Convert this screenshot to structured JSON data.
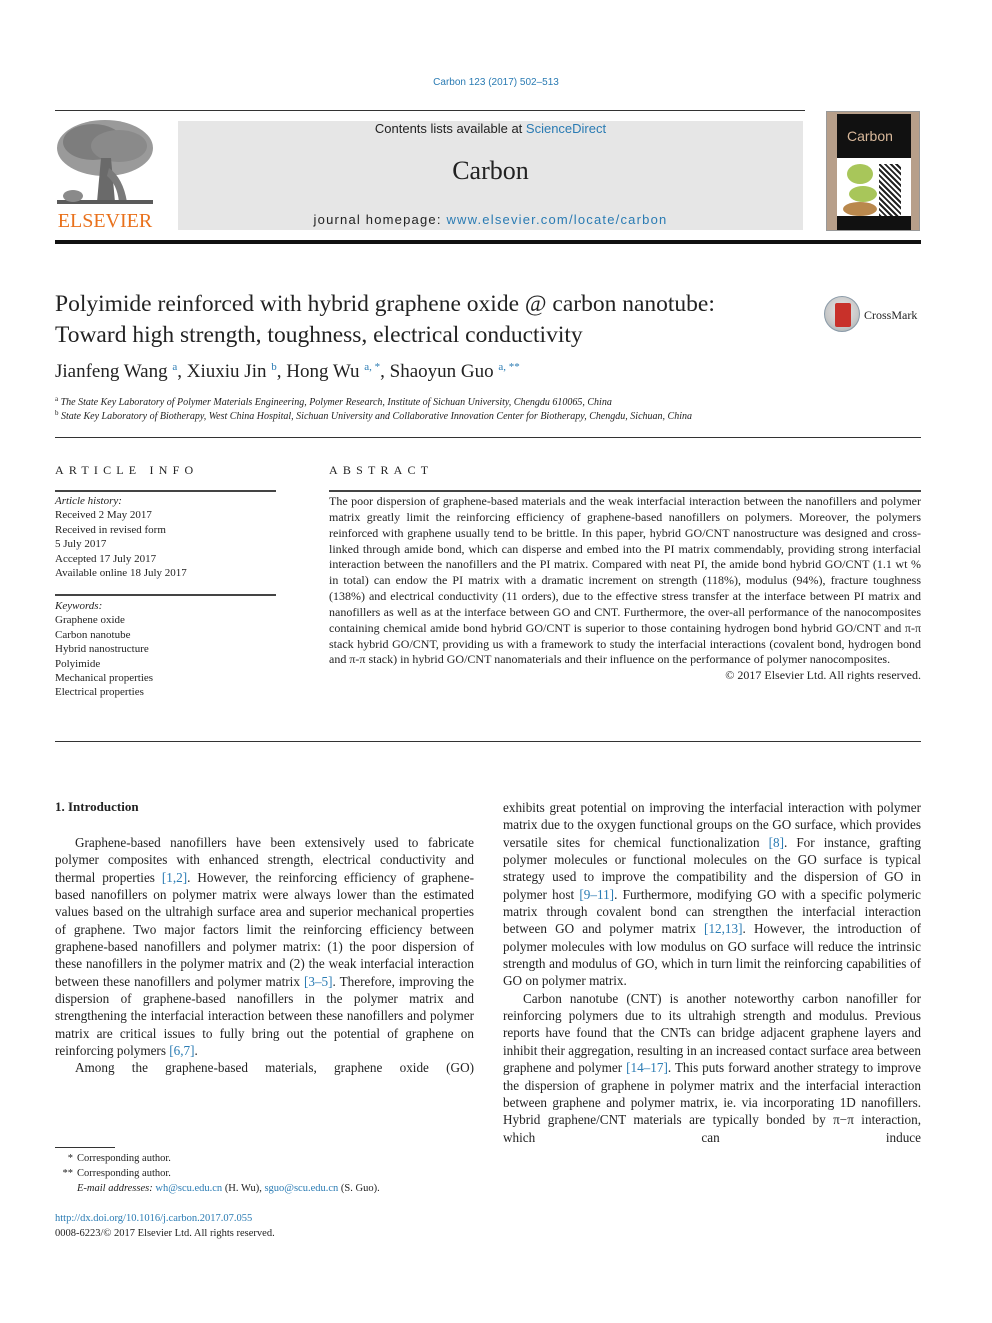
{
  "header": {
    "journal_ref": "Carbon 123 (2017) 502–513",
    "contents_prefix": "Contents lists available at ",
    "contents_link": "ScienceDirect",
    "journal_title": "Carbon",
    "homepage_prefix": "journal homepage: ",
    "homepage_link": "www.elsevier.com/locate/carbon",
    "publisher_logo_text": "ELSEVIER",
    "cover_title": "Carbon",
    "crossmark_label": "CrossMark",
    "colors": {
      "link": "#2a7bb3",
      "elsevier_orange": "#e9711c",
      "banner_bg": "#e6e6e6"
    }
  },
  "article": {
    "title_line1": "Polyimide reinforced with hybrid graphene oxide @ carbon nanotube:",
    "title_line2": "Toward high strength, toughness, electrical conductivity",
    "authors": [
      {
        "name": "Jianfeng Wang",
        "sup": "a"
      },
      {
        "name": "Xiuxiu Jin",
        "sup": "b"
      },
      {
        "name": "Hong Wu",
        "sup": "a, *"
      },
      {
        "name": "Shaoyun Guo",
        "sup": "a, **"
      }
    ],
    "affiliations": [
      {
        "mark": "a",
        "text": "The State Key Laboratory of Polymer Materials Engineering, Polymer Research, Institute of Sichuan University, Chengdu 610065, China"
      },
      {
        "mark": "b",
        "text": "State Key Laboratory of Biotherapy, West China Hospital, Sichuan University and Collaborative Innovation Center for Biotherapy, Chengdu, Sichuan, China"
      }
    ]
  },
  "article_info": {
    "heading": "ARTICLE INFO",
    "history_label": "Article history:",
    "history": [
      "Received 2 May 2017",
      "Received in revised form",
      "5 July 2017",
      "Accepted 17 July 2017",
      "Available online 18 July 2017"
    ],
    "keywords_label": "Keywords:",
    "keywords": [
      "Graphene oxide",
      "Carbon nanotube",
      "Hybrid nanostructure",
      "Polyimide",
      "Mechanical properties",
      "Electrical properties"
    ]
  },
  "abstract": {
    "heading": "ABSTRACT",
    "text": "The poor dispersion of graphene-based materials and the weak interfacial interaction between the nanofillers and polymer matrix greatly limit the reinforcing efficiency of graphene-based nanofillers on polymers. Moreover, the polymers reinforced with graphene usually tend to be brittle. In this paper, hybrid GO/CNT nanostructure was designed and cross-linked through amide bond, which can disperse and embed into the PI matrix commendably, providing strong interfacial interaction between the nanofillers and the PI matrix. Compared with neat PI, the amide bond hybrid GO/CNT (1.1 wt % in total) can endow the PI matrix with a dramatic increment on strength (118%), modulus (94%), fracture toughness (138%) and electrical conductivity (11 orders), due to the effective stress transfer at the interface between PI matrix and nanofillers as well as at the interface between GO and CNT. Furthermore, the over-all performance of the nanocomposites containing chemical amide bond hybrid GO/CNT is superior to those containing hydrogen bond hybrid GO/CNT and π-π stack hybrid GO/CNT, providing us with a framework to study the interfacial interactions (covalent bond, hydrogen bond and π-π stack) in hybrid GO/CNT nanomaterials and their influence on the performance of polymer nanocomposites.",
    "copyright": "© 2017 Elsevier Ltd. All rights reserved."
  },
  "intro": {
    "heading": "1.  Introduction",
    "left_p1": [
      {
        "t": "Graphene-based nanofillers have been extensively used to fabricate polymer composites with enhanced strength, electrical conductivity and thermal properties "
      },
      {
        "c": "[1,2]"
      },
      {
        "t": ". However, the reinforcing efficiency of graphene-based nanofillers on polymer matrix were always lower than the estimated values based on the ultrahigh surface area and superior mechanical properties of graphene. Two major factors limit the reinforcing efficiency between graphene-based nanofillers and polymer matrix: (1) the poor dispersion of these nanofillers in the polymer matrix and (2) the weak interfacial interaction between these nanofillers and polymer matrix "
      },
      {
        "c": "[3–5]"
      },
      {
        "t": ". Therefore, improving the dispersion of graphene-based nanofillers in the polymer matrix and strengthening the interfacial interaction between these nanofillers and polymer matrix are critical issues to fully bring out the potential of graphene on reinforcing polymers "
      },
      {
        "c": "[6,7]"
      },
      {
        "t": "."
      }
    ],
    "left_p2": "Among the graphene-based materials, graphene oxide (GO)",
    "right_p1": [
      {
        "t": "exhibits great potential on improving the interfacial interaction with polymer matrix due to the oxygen functional groups on the GO surface, which provides versatile sites for chemical functionalization "
      },
      {
        "c": "[8]"
      },
      {
        "t": ". For instance, grafting polymer molecules or functional molecules on the GO surface is typical strategy used to improve the compatibility and the dispersion of GO in polymer host "
      },
      {
        "c": "[9–11]"
      },
      {
        "t": ". Furthermore, modifying GO with a specific polymeric matrix through covalent bond can strengthen the interfacial interaction between GO and polymer matrix "
      },
      {
        "c": "[12,13]"
      },
      {
        "t": ". However, the introduction of polymer molecules with low modulus on GO surface will reduce the intrinsic strength and modulus of GO, which in turn limit the reinforcing capabilities of GO on polymer matrix."
      }
    ],
    "right_p2": [
      {
        "t": "Carbon nanotube (CNT) is another noteworthy carbon nanofiller for reinforcing polymers due to its ultrahigh strength and modulus. Previous reports have found that the CNTs can bridge adjacent graphene layers and inhibit their aggregation, resulting in an increased contact surface area between graphene and polymer "
      },
      {
        "c": "[14–17]"
      },
      {
        "t": ". This puts forward another strategy to improve the dispersion of graphene in polymer matrix and the interfacial interaction between graphene and polymer matrix, ie. via incorporating 1D nanofillers. Hybrid graphene/CNT materials are typically bonded by π−π interaction, which can induce"
      }
    ]
  },
  "footnotes": {
    "items": [
      {
        "mark": "*",
        "text": "Corresponding author."
      },
      {
        "mark": "**",
        "text": "Corresponding author."
      }
    ],
    "email_label": "E-mail addresses: ",
    "email1": "wh@scu.edu.cn",
    "email1_owner": " (H. Wu), ",
    "email2": "sguo@scu.edu.cn",
    "email2_owner": " (S. Guo).",
    "doi": "http://dx.doi.org/10.1016/j.carbon.2017.07.055",
    "issn_line": "0008-6223/© 2017 Elsevier Ltd. All rights reserved."
  }
}
